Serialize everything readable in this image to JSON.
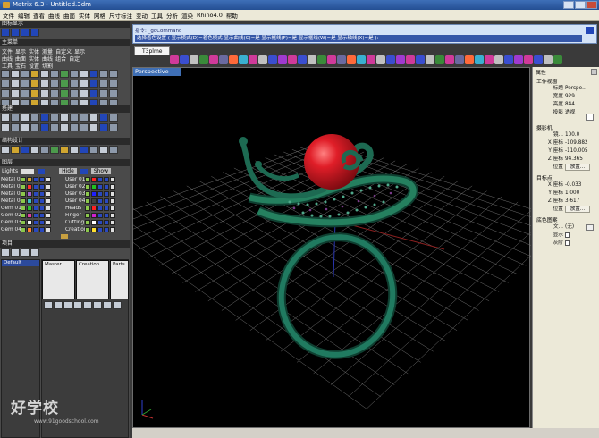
{
  "window": {
    "title": "Matrix 6.3 - Untitled.3dm"
  },
  "menu": {
    "items": [
      "文件",
      "编辑",
      "查看",
      "曲线",
      "曲面",
      "实体",
      "网格",
      "尺寸标注",
      "变动",
      "工具",
      "分析",
      "渲染",
      "Rhino4.0",
      "帮助"
    ]
  },
  "left": {
    "header_top": "图标显示",
    "header_main": "主菜单",
    "tabs1": [
      "文件",
      "显示",
      "实体",
      "测量",
      "自定义",
      "显示"
    ],
    "tabs2": [
      "曲线",
      "曲面",
      "实体",
      "曲线",
      "组合",
      "自定"
    ],
    "tabs3": [
      "工具",
      "宝石",
      "设置",
      "切割"
    ],
    "header_build": "搭建",
    "header_struct": "结构设计",
    "header_layers": "图层",
    "lights_label": "Lights",
    "hide_label": "Hide",
    "show_label": "Show",
    "layers_left": [
      "Metal 01",
      "Metal 02",
      "Metal 03",
      "Metal 04",
      "Gem 01",
      "Gem 02",
      "Gem 03",
      "Gem 04"
    ],
    "layers_right": [
      "User 01",
      "User 02",
      "User 03",
      "User 04",
      "Heads",
      "Finger",
      "Cutting",
      "Creation"
    ],
    "header_project": "项目",
    "project_default": "Default",
    "project_cols": [
      "Master",
      "Creation",
      "Parts"
    ]
  },
  "command": {
    "line1": "指令: _goCommand",
    "line2": "选择着色设置 ( 显示模式(D)=着色模式  显示曲线(C)=是  显示框线(F)=是  显示框线(W)=是  显示轴线(X)=是 ):"
  },
  "viewport_tab": "T3plme",
  "viewport_label": "Perspective",
  "properties": {
    "title": "属性",
    "camera_title": "工作视窗",
    "rows1": [
      {
        "label": "标题",
        "value": "Perspe..."
      },
      {
        "label": "宽度",
        "value": "929"
      },
      {
        "label": "高度",
        "value": "844"
      },
      {
        "label": "投影",
        "value": "透视"
      }
    ],
    "section_lens": "摄影机",
    "rows2": [
      {
        "label": "镜...",
        "value": "100.0"
      },
      {
        "label": "X 座标",
        "value": "-109.882"
      },
      {
        "label": "Y 座标",
        "value": "-110.005"
      },
      {
        "label": "Z 座标",
        "value": "94.365"
      }
    ],
    "position_label": "位置",
    "place_button": "放置...",
    "section_target": "目标点",
    "rows3": [
      {
        "label": "X 座标",
        "value": "-0.033"
      },
      {
        "label": "Y 座标",
        "value": "1.000"
      },
      {
        "label": "Z 座标",
        "value": "3.617"
      }
    ],
    "section_bg": "底色图案",
    "rows4": [
      {
        "label": "文...",
        "value": "(无)"
      },
      {
        "label": "显示",
        "value": ""
      },
      {
        "label": "灰阶",
        "value": ""
      }
    ]
  },
  "watermark": {
    "main": "好学校",
    "sub": "www.91goodschool.com"
  },
  "colors": {
    "ring": "#1f6b54",
    "pearl": "#d81c24",
    "grid": "#7a7a7a",
    "title": "#2f5ea6"
  }
}
